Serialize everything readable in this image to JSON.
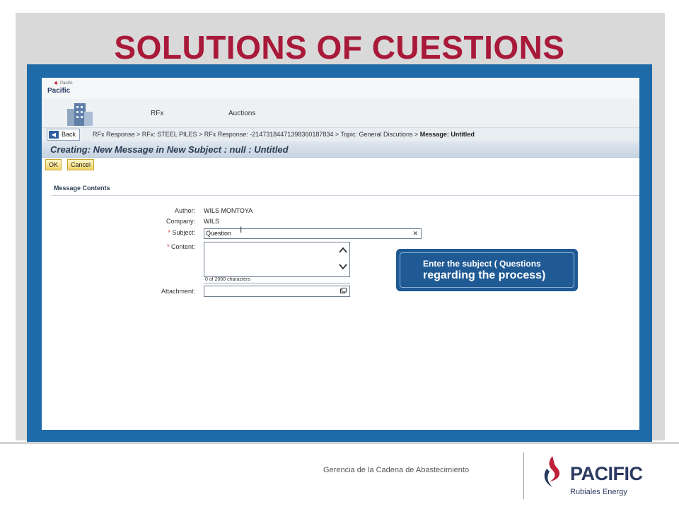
{
  "slide": {
    "title": "SOLUTIONS OF CUESTIONS",
    "footer_text": "Gerencia de la Cadena de Abastecimiento",
    "brand": {
      "word": "PACIFIC",
      "sub": "Rubiales Energy"
    }
  },
  "app": {
    "mini_logo": {
      "tag": "Pacific",
      "word": "Pacific"
    },
    "nav_tabs": [
      {
        "label": "RFx"
      },
      {
        "label": "Auctions"
      }
    ],
    "back_label": "Back",
    "breadcrumb": {
      "path": "RFx Response  >  RFx: STEEL PILES  >  RFx Response: -2147318447139836018783​4  >  Topic: General Discutions  >",
      "current": "Message: Untitled"
    },
    "header_title": "Creating: New Message in New Subject : null : Untitled",
    "buttons": {
      "ok": "OK",
      "cancel": "Cancel"
    },
    "section_title": "Message Contents",
    "form": {
      "author_label": "Author:",
      "author_value": "WILS MONTOYA",
      "company_label": "Company:",
      "company_value": "WILS",
      "required_mark": "*",
      "subject_label": "Subject:",
      "subject_value": "Question",
      "content_label": "Content:",
      "char_count": "0 of 2000 characters",
      "attachment_label": "Attachment:"
    },
    "callout": {
      "line1": "Enter the subject ( Questions",
      "line2": "regarding the process)"
    }
  },
  "colors": {
    "title": "#a8193a",
    "frame": "#1f6aa8",
    "callout": "#1f5a94",
    "brand": "#2b3a60"
  }
}
